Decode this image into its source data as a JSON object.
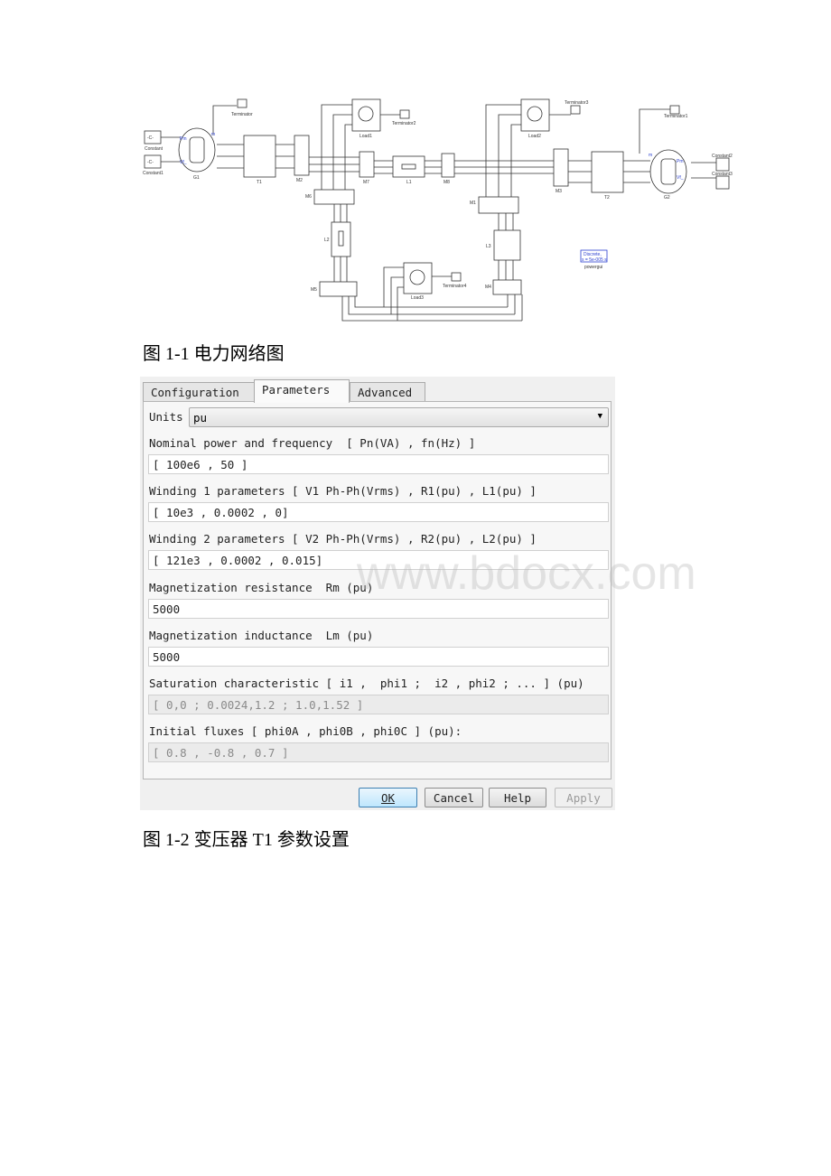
{
  "diagram": {
    "blocks": {
      "constant": "Constant",
      "constant1": "Constant1",
      "g1": "G1",
      "terminator": "Terminator",
      "t1": "T1",
      "m2": "M2",
      "load1": "Load1",
      "terminator2": "Terminator2",
      "m7": "M7",
      "l1": "L1",
      "m8": "M8",
      "m6": "M6",
      "l2": "L2",
      "m5": "M5",
      "load3": "Load3",
      "terminator4": "Terminator4",
      "load2": "Load2",
      "terminator3": "Terminator3",
      "m1": "M1",
      "l3": "L3",
      "m4": "M4",
      "m3": "M3",
      "t2": "T2",
      "g2": "G2",
      "terminator1": "Terminator1",
      "constant2": "Constant2",
      "constant3": "Constant3",
      "powergui_line1": "Discrete,",
      "powergui_line2": "s = 5e-005 s",
      "powergui": "powergui",
      "const_value": "-C-",
      "pm": "Pm",
      "vf": "Vf_",
      "m": "m"
    }
  },
  "caption1": "图 1-1 电力网络图",
  "dialog": {
    "tabs": [
      "Configuration",
      "Parameters",
      "Advanced"
    ],
    "active_tab": "Parameters",
    "units_label": "Units",
    "units_value": "pu",
    "fields": [
      {
        "label": "Nominal power and frequency  [ Pn(VA) , fn(Hz) ]",
        "value": "[ 100e6 , 50 ]",
        "disabled": false
      },
      {
        "label": "Winding 1 parameters [ V1 Ph-Ph(Vrms) , R1(pu) , L1(pu) ]",
        "value": "[ 10e3 , 0.0002 , 0]",
        "disabled": false
      },
      {
        "label": "Winding 2 parameters [ V2 Ph-Ph(Vrms) , R2(pu) , L2(pu) ]",
        "value": "[ 121e3 , 0.0002 , 0.015]",
        "disabled": false
      },
      {
        "label": "Magnetization resistance  Rm (pu)",
        "value": "5000",
        "disabled": false
      },
      {
        "label": "Magnetization inductance  Lm (pu)",
        "value": "5000",
        "disabled": false
      },
      {
        "label": "Saturation characteristic [ i1 ,  phi1 ;  i2 , phi2 ; ... ] (pu)",
        "value": "[ 0,0 ; 0.0024,1.2 ; 1.0,1.52 ]",
        "disabled": true
      },
      {
        "label": "Initial fluxes [ phi0A , phi0B , phi0C ] (pu):",
        "value": "[ 0.8 , -0.8 , 0.7 ]",
        "disabled": true
      }
    ],
    "buttons": {
      "ok": "OK",
      "cancel": "Cancel",
      "help": "Help",
      "apply": "Apply"
    }
  },
  "watermark": "www.bdocx.com",
  "caption2": "图 1-2 变压器 T1 参数设置"
}
